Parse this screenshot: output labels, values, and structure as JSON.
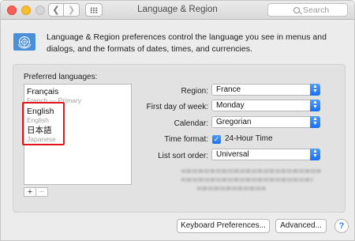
{
  "window": {
    "title": "Language & Region",
    "search_placeholder": "Search"
  },
  "header": {
    "flag_icon": "un-flag-icon",
    "description": "Language & Region preferences control the language you see in menus and dialogs, and the formats of dates, times, and currencies."
  },
  "preferred_languages": {
    "label": "Preferred languages:",
    "items": [
      {
        "name": "Français",
        "sub": "French — Primary"
      },
      {
        "name": "English",
        "sub": "English"
      },
      {
        "name": "日本語",
        "sub": "Japanese"
      }
    ],
    "add_label": "+",
    "remove_label": "−"
  },
  "settings": {
    "region": {
      "label": "Region:",
      "value": "France"
    },
    "first_day": {
      "label": "First day of week:",
      "value": "Monday"
    },
    "calendar": {
      "label": "Calendar:",
      "value": "Gregorian"
    },
    "time_format": {
      "label": "Time format:",
      "checkbox_label": "24-Hour Time",
      "checked": true
    },
    "sort_order": {
      "label": "List sort order:",
      "value": "Universal"
    }
  },
  "footer": {
    "keyboard_button": "Keyboard Preferences...",
    "advanced_button": "Advanced...",
    "help_label": "?"
  },
  "colors": {
    "accent": "#1a6ff2",
    "annotation_red": "#e0141b",
    "un_blue": "#4a90d9"
  }
}
